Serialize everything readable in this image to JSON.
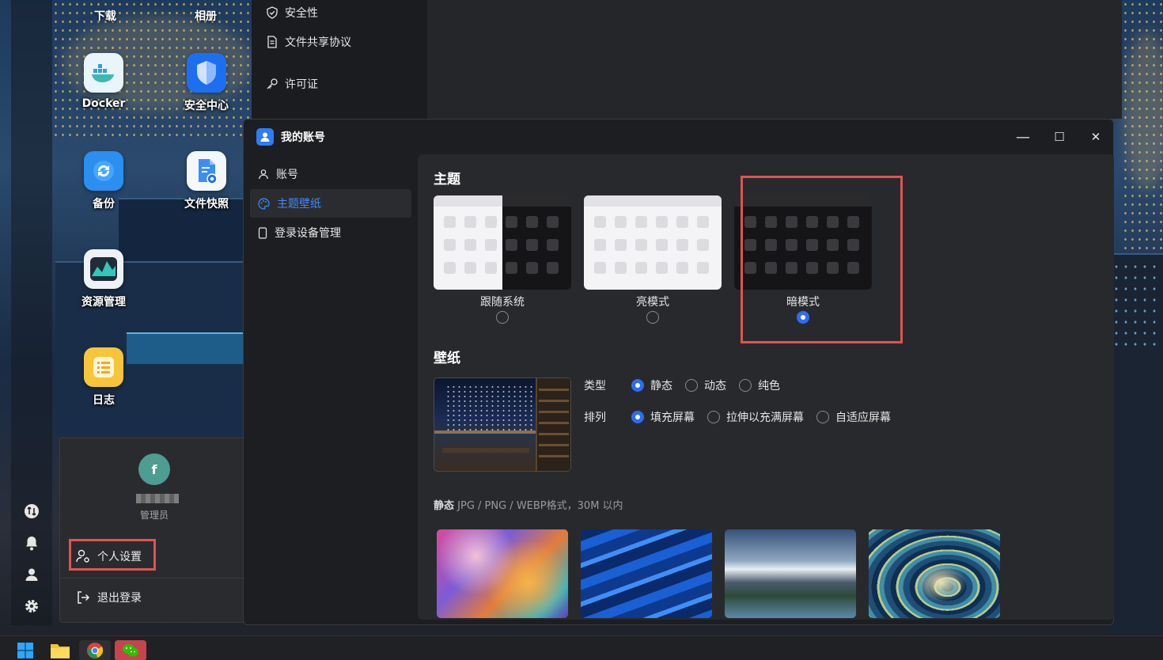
{
  "desktop": {
    "top_labels": [
      "下载",
      "相册"
    ],
    "apps": [
      {
        "label": "Docker",
        "icon": "docker-icon"
      },
      {
        "label": "安全中心",
        "icon": "shield-icon"
      },
      {
        "label": "备份",
        "icon": "sync-icon"
      },
      {
        "label": "文件快照",
        "icon": "file-camera-icon"
      },
      {
        "label": "资源管理",
        "icon": "chart-icon"
      },
      {
        "label": "日志",
        "icon": "list-icon"
      }
    ]
  },
  "bg_window": {
    "items": [
      {
        "label": "安全性",
        "icon": "shield-check-icon"
      },
      {
        "label": "文件共享协议",
        "icon": "document-icon"
      },
      {
        "label": "许可证",
        "icon": "key-icon"
      }
    ]
  },
  "user_popup": {
    "avatar_letter": "f",
    "role": "管理员",
    "items": [
      {
        "label": "个人设置",
        "icon": "user-settings-icon"
      },
      {
        "label": "退出登录",
        "icon": "logout-icon"
      }
    ]
  },
  "window": {
    "title": "我的账号",
    "controls": {
      "minimize": "—",
      "maximize": "☐",
      "close": "✕"
    },
    "sidebar": [
      {
        "label": "账号",
        "icon": "user-icon",
        "active": false
      },
      {
        "label": "主题壁纸",
        "icon": "palette-icon",
        "active": true
      },
      {
        "label": "登录设备管理",
        "icon": "phone-icon",
        "active": false
      }
    ],
    "theme": {
      "heading": "主题",
      "options": [
        {
          "label": "跟随系统",
          "selected": false
        },
        {
          "label": "亮模式",
          "selected": false
        },
        {
          "label": "暗模式",
          "selected": true
        }
      ]
    },
    "wallpaper": {
      "heading": "壁纸",
      "type_label": "类型",
      "type_options": [
        {
          "label": "静态",
          "selected": true
        },
        {
          "label": "动态",
          "selected": false
        },
        {
          "label": "纯色",
          "selected": false
        }
      ],
      "arrange_label": "排列",
      "arrange_options": [
        {
          "label": "填充屏幕",
          "selected": true
        },
        {
          "label": "拉伸以充满屏幕",
          "selected": false
        },
        {
          "label": "自适应屏幕",
          "selected": false
        }
      ],
      "hint_bold": "静态",
      "hint_text": " JPG / PNG / WEBP格式，30M 以内"
    }
  },
  "colors": {
    "accent": "#2f6cf5",
    "highlight": "#e05353",
    "window_bg": "#1d1e21",
    "panel_bg": "#28292d"
  },
  "taskbar": {
    "icons": [
      "windows-start-icon",
      "file-explorer-icon",
      "chrome-icon",
      "wechat-icon"
    ]
  }
}
